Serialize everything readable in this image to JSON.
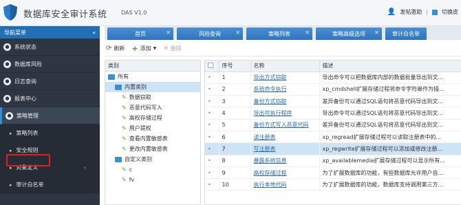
{
  "header": {
    "title": "数据库安全审计系统",
    "version": "DAS V1.0",
    "user_label": "发帖邀助",
    "right_label": "切换皮"
  },
  "sidebar": {
    "title": "导航菜单",
    "collapse": "«",
    "items": [
      {
        "label": "系统状态",
        "icon": "status-icon"
      },
      {
        "label": "数据库风险",
        "icon": "db-risk-icon"
      },
      {
        "label": "日志查询",
        "icon": "log-icon"
      },
      {
        "label": "报表中心",
        "icon": "report-icon"
      },
      {
        "label": "策略管理",
        "icon": "policy-icon"
      }
    ],
    "subitems": [
      {
        "label": "策略列表"
      },
      {
        "label": "安全规则"
      },
      {
        "label": "对象定义",
        "chevron": "‹"
      },
      {
        "label": "审计白名单"
      }
    ]
  },
  "tabs": [
    {
      "label": "首页"
    },
    {
      "label": "风险查询"
    },
    {
      "label": "策略列表"
    },
    {
      "label": "策略高级选项"
    },
    {
      "label": "审计白名单"
    }
  ],
  "toolbar": {
    "refresh": "刷新",
    "add": "添加",
    "delete": "删除"
  },
  "tree": {
    "header": "类别",
    "nodes": [
      {
        "label": "所有",
        "type": "folder",
        "indent": 0
      },
      {
        "label": "内置类别",
        "type": "folder",
        "indent": 1,
        "selected": true
      },
      {
        "label": "数据窃取",
        "type": "leaf",
        "indent": 2
      },
      {
        "label": "恶意代码写入",
        "type": "leaf",
        "indent": 2
      },
      {
        "label": "高权存储过程",
        "type": "leaf",
        "indent": 2
      },
      {
        "label": "用户提权",
        "type": "leaf",
        "indent": 2
      },
      {
        "label": "查看内置敏感表",
        "type": "leaf",
        "indent": 2
      },
      {
        "label": "更改内置敏感表",
        "type": "leaf",
        "indent": 2
      },
      {
        "label": "自定义类别",
        "type": "folder",
        "indent": 1
      },
      {
        "label": "c",
        "type": "leaf",
        "indent": 2
      },
      {
        "label": "fv",
        "type": "leaf",
        "indent": 2
      }
    ]
  },
  "grid": {
    "columns": [
      "",
      "序号",
      "名称",
      "描述"
    ],
    "rows": [
      {
        "idx": "1",
        "name": "导出方式窃取",
        "desc": "导出命令可以把数据库内部的数据批量导出到文..."
      },
      {
        "idx": "2",
        "name": "系统命令执行",
        "desc": "xp_cmdshell扩展存储过程将命令字符串作为操..."
      },
      {
        "idx": "3",
        "name": "备份方式窃取",
        "desc": "差异备份可以通过SQL语句将恶意代码导出到文..."
      },
      {
        "idx": "4",
        "name": "导出可执行程序",
        "desc": "导出命令可以通过SQL语句将恶意代码导出到文..."
      },
      {
        "idx": "5",
        "name": "备份方式写入恶意代码",
        "desc": "差异备份可以通过SQL语句将恶意代码导出到文..."
      },
      {
        "idx": "6",
        "name": "读注册表",
        "desc": "xp_regread扩展存储过程可以读取注册表中的..."
      },
      {
        "idx": "7",
        "name": "写注册表",
        "desc": "xp_regwrite扩展存储过程可以添加或修改注册...",
        "selected": true
      },
      {
        "idx": "8",
        "name": "暴露系统信息",
        "desc": "xp_availablemedia扩展存储过程可以显示所有..."
      },
      {
        "idx": "9",
        "name": "高权存储过程",
        "desc": "为了扩展数据库的功能，有些数据库允许用户自..."
      },
      {
        "idx": "10",
        "name": "执行本地代码",
        "desc": "为了扩展数据库的功能，数据库支持调用第三方..."
      }
    ]
  },
  "colors": {
    "accent": "#236fb5",
    "sidebar_bg": "#2d3642",
    "highlight": "#e01f1f"
  }
}
